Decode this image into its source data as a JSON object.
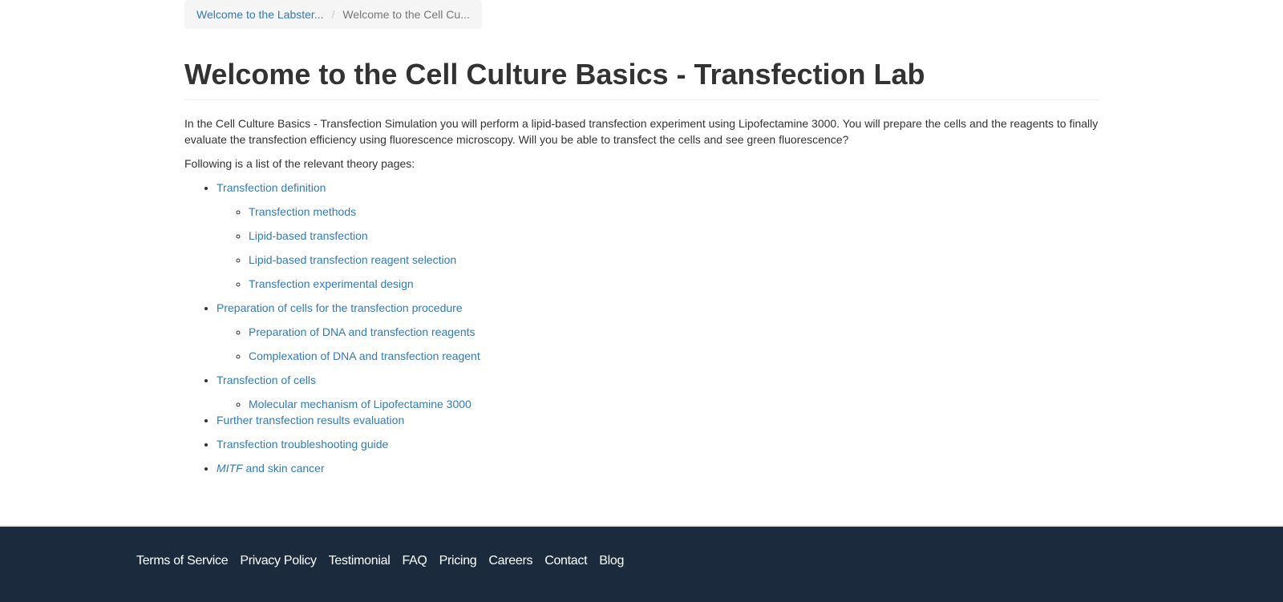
{
  "breadcrumb": {
    "items": [
      {
        "label": "Welcome to the Labster..."
      },
      {
        "label": "Welcome to the Cell Cu..."
      }
    ],
    "separator": "/"
  },
  "page": {
    "title": "Welcome to the Cell Culture Basics - Transfection Lab",
    "intro": "In the Cell Culture Basics - Transfection Simulation you will perform a lipid-based transfection experiment using Lipofectamine 3000. You will prepare the cells and the reagents to finally evaluate the transfection efficiency using fluorescence microscopy. Will you be able to transfect the cells and see green fluorescence?",
    "lead_in": "Following is a list of the relevant theory pages:"
  },
  "topics": [
    {
      "label": "Transfection definition",
      "children": [
        {
          "label": "Transfection methods"
        },
        {
          "label": "Lipid-based transfection"
        },
        {
          "label": "Lipid-based transfection reagent selection"
        },
        {
          "label": "Transfection experimental design"
        }
      ]
    },
    {
      "label": "Preparation of cells for the transfection procedure",
      "children": [
        {
          "label": "Preparation of DNA and transfection reagents"
        },
        {
          "label": "Complexation of DNA and transfection reagent"
        }
      ]
    },
    {
      "label": "Transfection of cells",
      "children": [
        {
          "label": "Molecular mechanism of Lipofectamine 3000"
        }
      ]
    },
    {
      "label": "Further transfection results evaluation"
    },
    {
      "label": "Transfection troubleshooting guide"
    },
    {
      "label_italic": "MITF",
      "label_rest": " and skin cancer"
    }
  ],
  "footer": {
    "links": [
      {
        "label": "Terms of Service"
      },
      {
        "label": "Privacy Policy"
      },
      {
        "label": "Testimonial"
      },
      {
        "label": "FAQ"
      },
      {
        "label": "Pricing"
      },
      {
        "label": "Careers"
      },
      {
        "label": "Contact"
      },
      {
        "label": "Blog"
      }
    ]
  },
  "colors": {
    "link": "#337ab7",
    "text": "#333333",
    "footer_bg": "#1b2a3d",
    "breadcrumb_bg": "#f5f5f5"
  }
}
